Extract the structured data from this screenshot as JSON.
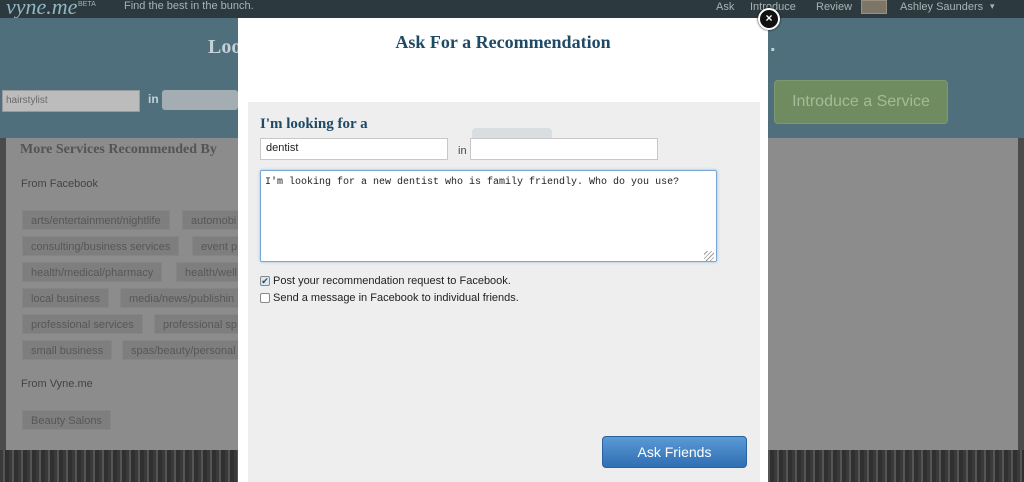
{
  "topbar": {
    "logo": "vyne.me",
    "beta": "BETA",
    "tagline": "Find the best in the bunch.",
    "nav": [
      "Ask",
      "Introduce",
      "Review"
    ],
    "user_name": "Ashley Saunders",
    "caret": "▾"
  },
  "hero": {
    "title_fragment": "Loo",
    "title_end": ".",
    "search_value": "hairstylist",
    "in_label": "in",
    "introduce_button": "Introduce a Service"
  },
  "services": {
    "title": "More Services Recommended By",
    "facebook_label": "From Facebook",
    "facebook_tags": [
      [
        "arts/entertainment/nightlife",
        "automobi"
      ],
      [
        "consulting/business services",
        "event p"
      ],
      [
        "health/medical/pharmacy",
        "health/well"
      ],
      [
        "local business",
        "media/news/publishin"
      ],
      [
        "professional services",
        "professional sp"
      ],
      [
        "small business",
        "spas/beauty/personal"
      ]
    ],
    "vyne_label": "From Vyne.me",
    "vyne_tags": [
      "Beauty Salons"
    ]
  },
  "modal": {
    "title": "Ask For a Recommendation",
    "looking_label": "I'm looking for a",
    "service_value": "dentist",
    "in_label": "in",
    "location_value": "",
    "message": "I'm looking for a new dentist who is family friendly. Who do you use?",
    "post_to_facebook": {
      "label": "Post your recommendation request to Facebook.",
      "checked": true
    },
    "send_message": {
      "label": "Send a message in Facebook to individual friends.",
      "checked": false
    },
    "ask_button": "Ask Friends",
    "close_glyph": "×"
  }
}
